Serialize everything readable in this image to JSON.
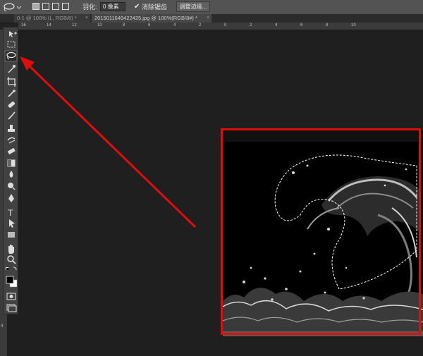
{
  "options_bar": {
    "tool_icon": "lasso-icon",
    "feather_label": "羽化:",
    "feather_value": "0 像素",
    "anti_alias_label": "消除锯齿",
    "refine_edge_label": "调整边缘..."
  },
  "tabs": [
    {
      "label": "0-1 @ 100% (L, RGB/8) *",
      "close": "×"
    },
    {
      "label": "20150116494224​25.jpg @ 100%(RGB/8#) *",
      "close": "×"
    }
  ],
  "ruler_h": [
    "16",
    "14",
    "12",
    "10",
    "8",
    "6",
    "4",
    "2",
    "0",
    "2",
    "4",
    "6",
    "8",
    "10"
  ],
  "ruler_v": [
    "4"
  ],
  "tools": [
    {
      "name": "move-icon",
      "glyph": "✥"
    },
    {
      "name": "marquee-icon",
      "glyph": "⬚"
    },
    {
      "name": "lasso-icon",
      "glyph": "◯",
      "active": true
    },
    {
      "name": "magic-wand-icon",
      "glyph": "✶"
    },
    {
      "name": "crop-icon",
      "glyph": "⌗"
    },
    {
      "name": "eyedropper-icon",
      "glyph": "/"
    },
    {
      "name": "healing-brush-icon",
      "glyph": "✚"
    },
    {
      "name": "brush-icon",
      "glyph": "✎"
    },
    {
      "name": "stamp-icon",
      "glyph": "▟"
    },
    {
      "name": "history-brush-icon",
      "glyph": "↺"
    },
    {
      "name": "eraser-icon",
      "glyph": "▰"
    },
    {
      "name": "gradient-icon",
      "glyph": "▣"
    },
    {
      "name": "blur-icon",
      "glyph": "●"
    },
    {
      "name": "dodge-icon",
      "glyph": "◐"
    },
    {
      "name": "pen-icon",
      "glyph": "✒"
    },
    {
      "name": "type-icon",
      "glyph": "T"
    },
    {
      "name": "path-select-icon",
      "glyph": "➤"
    },
    {
      "name": "shape-icon",
      "glyph": "■"
    },
    {
      "name": "hand-icon",
      "glyph": "✋"
    },
    {
      "name": "zoom-icon",
      "glyph": "⚲"
    }
  ],
  "colors": {
    "annotation_red": "#e10d0d",
    "foreground": "#000000",
    "background": "#ffffff"
  }
}
